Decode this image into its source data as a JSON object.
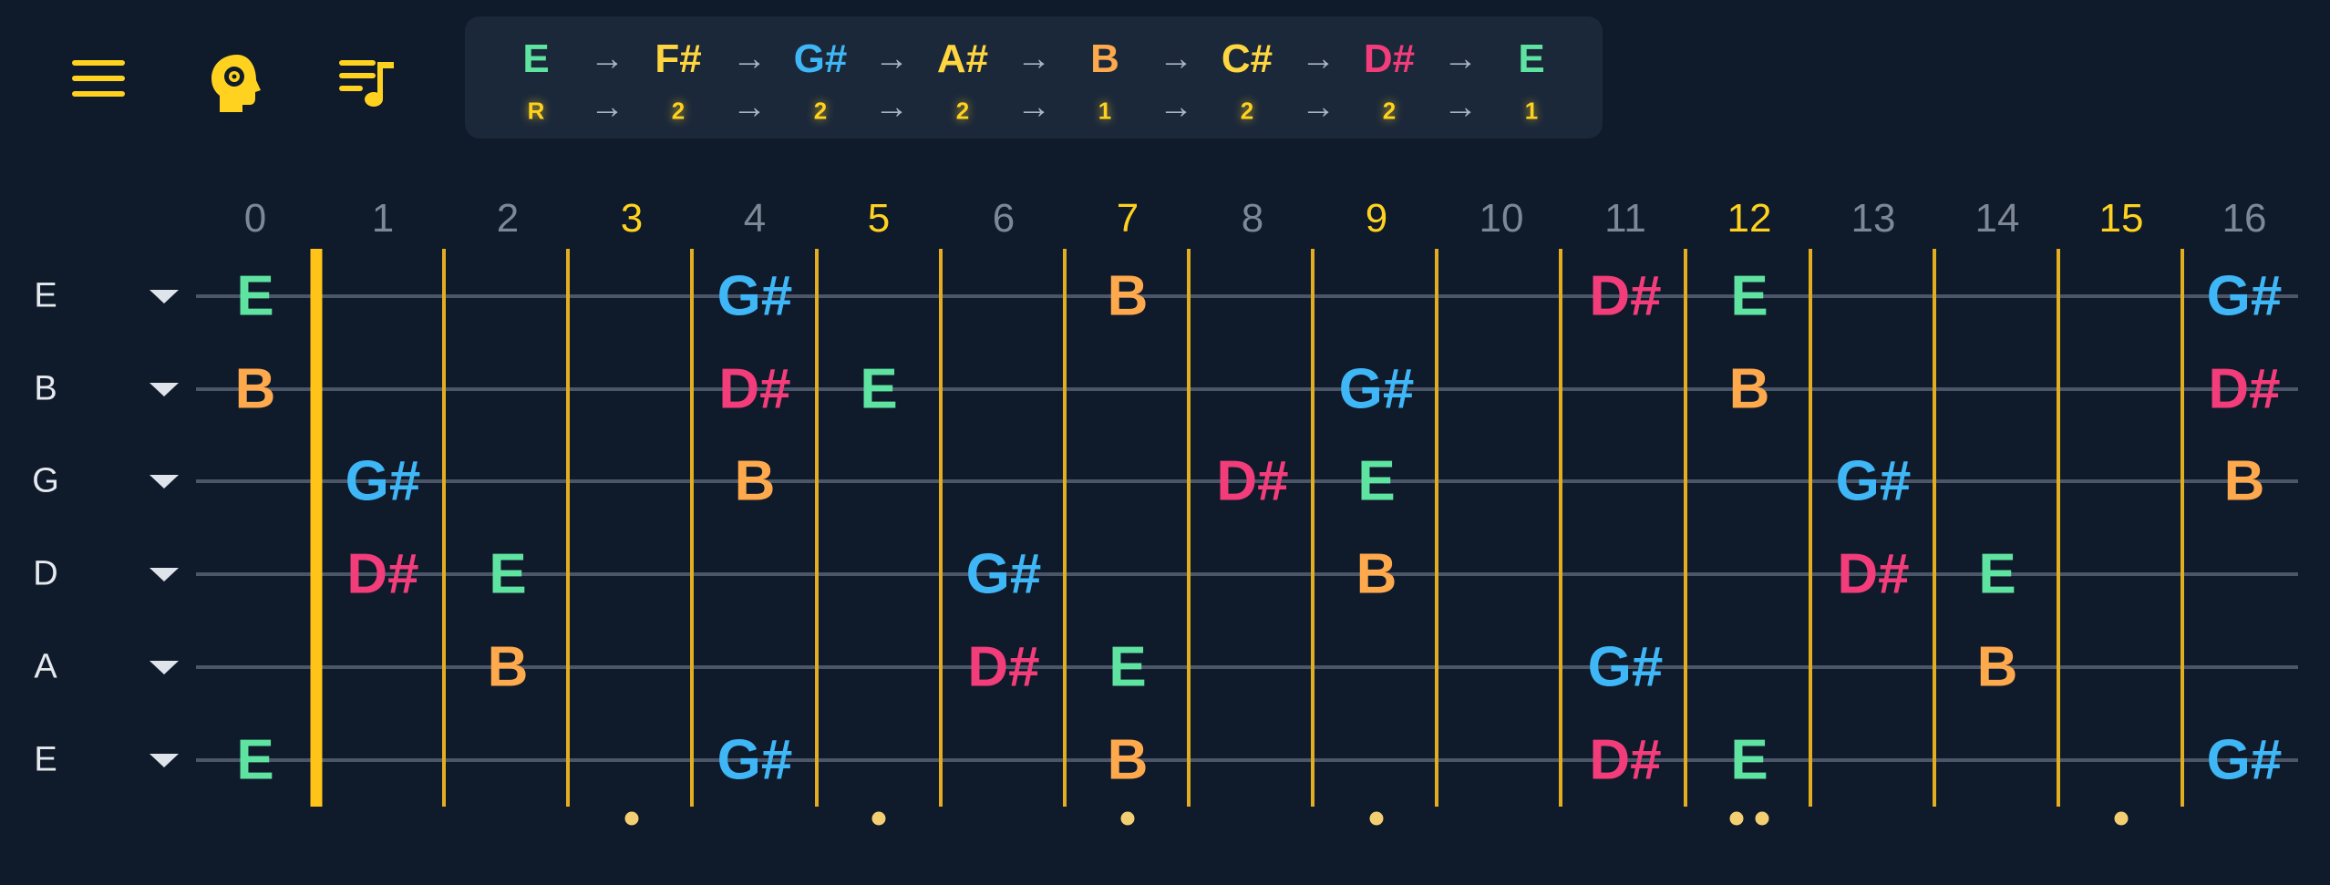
{
  "toolbar": {
    "menu_icon": "menu-icon",
    "settings_icon": "brain-gear-icon",
    "playlist_icon": "playlist-music-icon",
    "accent_color": "#ffd21f"
  },
  "scale_formula": {
    "notes": [
      "E",
      "F#",
      "G#",
      "A#",
      "B",
      "C#",
      "D#",
      "E"
    ],
    "intervals": [
      "R",
      "2",
      "2",
      "2",
      "1",
      "2",
      "2",
      "1"
    ],
    "note_colors": [
      "#5fe3a1",
      "#ffd640",
      "#3fb6f5",
      "#ffd640",
      "#ffa94d",
      "#ffd640",
      "#f23d7a",
      "#5fe3a1"
    ],
    "arrow_glyph": "→"
  },
  "fret_numbers": [
    "0",
    "1",
    "2",
    "3",
    "4",
    "5",
    "6",
    "7",
    "8",
    "9",
    "10",
    "11",
    "12",
    "13",
    "14",
    "15",
    "16"
  ],
  "inlay_frets": [
    "3",
    "5",
    "7",
    "9",
    "12",
    "15"
  ],
  "fret_number_colors": {
    "normal": "#7d8796",
    "inlay": "#ffd21f"
  },
  "strings": [
    {
      "name": "E",
      "notes": [
        [
          0,
          "E"
        ],
        [
          4,
          "G#"
        ],
        [
          7,
          "B"
        ],
        [
          11,
          "D#"
        ],
        [
          12,
          "E"
        ],
        [
          16,
          "G#"
        ]
      ]
    },
    {
      "name": "B",
      "notes": [
        [
          0,
          "B"
        ],
        [
          4,
          "D#"
        ],
        [
          5,
          "E"
        ],
        [
          9,
          "G#"
        ],
        [
          12,
          "B"
        ],
        [
          16,
          "D#"
        ]
      ]
    },
    {
      "name": "G",
      "notes": [
        [
          1,
          "G#"
        ],
        [
          4,
          "B"
        ],
        [
          8,
          "D#"
        ],
        [
          9,
          "E"
        ],
        [
          13,
          "G#"
        ],
        [
          16,
          "B"
        ]
      ]
    },
    {
      "name": "D",
      "notes": [
        [
          1,
          "D#"
        ],
        [
          2,
          "E"
        ],
        [
          6,
          "G#"
        ],
        [
          9,
          "B"
        ],
        [
          13,
          "D#"
        ],
        [
          14,
          "E"
        ]
      ]
    },
    {
      "name": "A",
      "notes": [
        [
          2,
          "B"
        ],
        [
          6,
          "D#"
        ],
        [
          7,
          "E"
        ],
        [
          11,
          "G#"
        ],
        [
          14,
          "B"
        ]
      ]
    },
    {
      "name": "E",
      "notes": [
        [
          0,
          "E"
        ],
        [
          4,
          "G#"
        ],
        [
          7,
          "B"
        ],
        [
          11,
          "D#"
        ],
        [
          12,
          "E"
        ],
        [
          16,
          "G#"
        ]
      ]
    }
  ],
  "note_colors": {
    "E": "#5fe3a1",
    "G#": "#3fb6f5",
    "B": "#ffa94d",
    "D#": "#f23d7a",
    "F#": "#ffd640",
    "A#": "#ffd640",
    "C#": "#ffd640"
  },
  "markers": [
    [
      3,
      1
    ],
    [
      5,
      1
    ],
    [
      7,
      1
    ],
    [
      9,
      1
    ],
    [
      12,
      2
    ],
    [
      15,
      1
    ]
  ]
}
